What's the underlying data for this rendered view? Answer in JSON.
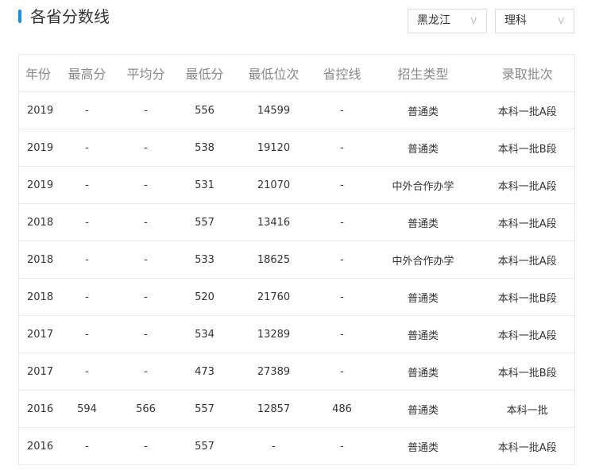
{
  "title": "各省分数线",
  "filters": {
    "province": "黑龙江",
    "subject": "理科",
    "chevron": "V"
  },
  "table": {
    "headers": [
      "年份",
      "最高分",
      "平均分",
      "最低分",
      "最低位次",
      "省控线",
      "招生类型",
      "录取批次"
    ],
    "rows": [
      [
        "2019",
        "-",
        "-",
        "556",
        "14599",
        "-",
        "普通类",
        "本科一批A段"
      ],
      [
        "2019",
        "-",
        "-",
        "538",
        "19120",
        "-",
        "普通类",
        "本科一批B段"
      ],
      [
        "2019",
        "-",
        "-",
        "531",
        "21070",
        "-",
        "中外合作办学",
        "本科一批A段"
      ],
      [
        "2018",
        "-",
        "-",
        "557",
        "13416",
        "-",
        "普通类",
        "本科一批A段"
      ],
      [
        "2018",
        "-",
        "-",
        "533",
        "18625",
        "-",
        "中外合作办学",
        "本科一批A段"
      ],
      [
        "2018",
        "-",
        "-",
        "520",
        "21760",
        "-",
        "普通类",
        "本科一批B段"
      ],
      [
        "2017",
        "-",
        "-",
        "534",
        "13289",
        "-",
        "普通类",
        "本科一批A段"
      ],
      [
        "2017",
        "-",
        "-",
        "473",
        "27389",
        "-",
        "普通类",
        "本科一批B段"
      ],
      [
        "2016",
        "594",
        "566",
        "557",
        "12857",
        "486",
        "普通类",
        "本科一批"
      ],
      [
        "2016",
        "-",
        "-",
        "557",
        "-",
        "-",
        "普通类",
        "本科一批A段"
      ]
    ]
  },
  "colors": {
    "accent": "#1a8ee0"
  }
}
